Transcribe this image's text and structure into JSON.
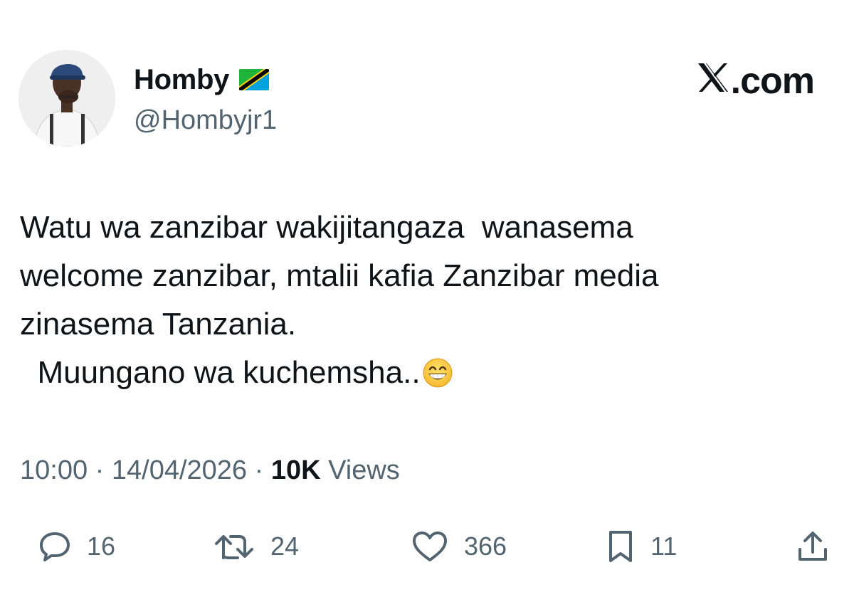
{
  "author": {
    "display_name": "Homby",
    "handle": "@Hombyjr1",
    "flag_icon": "tanzania-flag-icon"
  },
  "brand": {
    "text": ".com",
    "logo_icon": "x-logo-icon"
  },
  "tweet": {
    "lines": [
      "Watu wa zanzibar wakijitangaza  wanasema",
      "welcome zanzibar, mtalii kafia Zanzibar media",
      "zinasema Tanzania.",
      "  Muungano wa kuchemsha.."
    ],
    "emoji": "grinning-face-icon"
  },
  "meta": {
    "time": "10:00",
    "separator": " · ",
    "date": "14/04/2026",
    "views_count": "10K",
    "views_label": " Views"
  },
  "actions": {
    "replies": "16",
    "reposts": "24",
    "likes": "366",
    "bookmarks": "11"
  },
  "colors": {
    "text_primary": "#0f1419",
    "text_secondary": "#536471",
    "flag_green": "#1eb53a",
    "flag_blue": "#00a3dd",
    "flag_yellow": "#fcd116"
  }
}
